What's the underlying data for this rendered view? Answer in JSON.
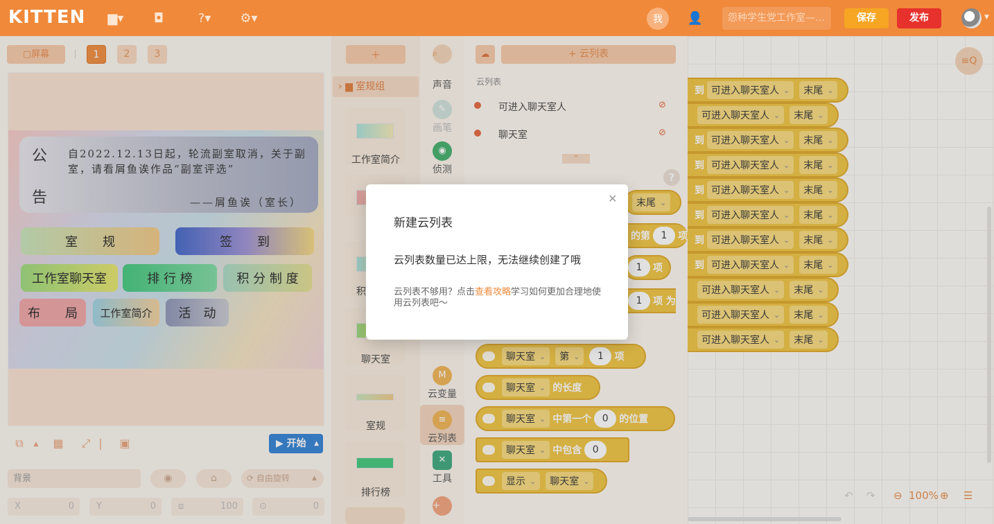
{
  "topbar": {
    "logo": "KITTEN",
    "me_label": "我",
    "project_name": "怨种学生党工作室—…",
    "save_label": "保存",
    "publish_label": "发布",
    "accent": "#f0893a"
  },
  "stage_toolbar": {
    "screen_label": "▢屏幕",
    "pages": [
      "1",
      "2",
      "3"
    ],
    "active_page": "1"
  },
  "stage": {
    "notice_char_1": "公",
    "notice_char_2": "告",
    "notice_text": "自2022.12.13日起，轮流副室取消，关于副室，请看屑鱼诶作品“副室评选”",
    "notice_sign": "——屑鱼诶（室长）",
    "chips": [
      "室　　规",
      "签　　到",
      "工作室聊天室",
      "排 行 榜",
      "积 分 制 度",
      "布　　局",
      "工作室简介",
      "活　动"
    ]
  },
  "stage_controls": {
    "start_label": "开始",
    "background_label": "背景",
    "rotate_label": "自由旋转",
    "x_label": "X",
    "x_value": "0",
    "y_label": "Y",
    "y_value": "0",
    "size_value": "100",
    "direction_value": "0"
  },
  "sprites": {
    "add_label": "+",
    "folder_label": "室规组",
    "items": [
      "工作室简介",
      "积",
      "聊天室",
      "室规",
      "排行榜"
    ]
  },
  "categories": {
    "items": [
      "声音",
      "画笔",
      "侦测",
      "云变量",
      "云列表",
      "工具"
    ],
    "active": "云列表"
  },
  "palette": {
    "add_cloud_list_label": "+ 云列表",
    "caption": "云列表",
    "cloud_lists": [
      "可进入聊天室人",
      "聊天室"
    ],
    "blocks": {
      "b1_list": "聊天室",
      "b1_word": "第",
      "b1_num": "1",
      "b1_tail": "项",
      "b2_list": "聊天室",
      "b2_tail": "的长度",
      "b3_list": "聊天室",
      "b3_mid": "中第一个",
      "b3_num": "0",
      "b3_tail": "的位置",
      "b4_list": "聊天室",
      "b4_mid": "中包含",
      "b4_num": "0",
      "b5_head": "显示",
      "b5_list": "聊天室",
      "partial_tail": "末尾",
      "partial_de_di": "的第",
      "partial_num": "1",
      "partial_xiang": "项",
      "partial_xiang_wei": "项 为"
    }
  },
  "workspace": {
    "block_list": "可进入聊天室人",
    "block_end": "末尾",
    "prefixes": [
      "到",
      "",
      "到",
      "到",
      "到",
      "到",
      "到",
      "到",
      "",
      "",
      ""
    ],
    "zoom": "100%"
  },
  "modal": {
    "title": "新建云列表",
    "message": "云列表数量已达上限，无法继续创建了哦",
    "help_prefix": "云列表不够用？点击",
    "help_link": "查看攻略",
    "help_suffix": "学习如何更加合理地使用云列表吧～"
  }
}
